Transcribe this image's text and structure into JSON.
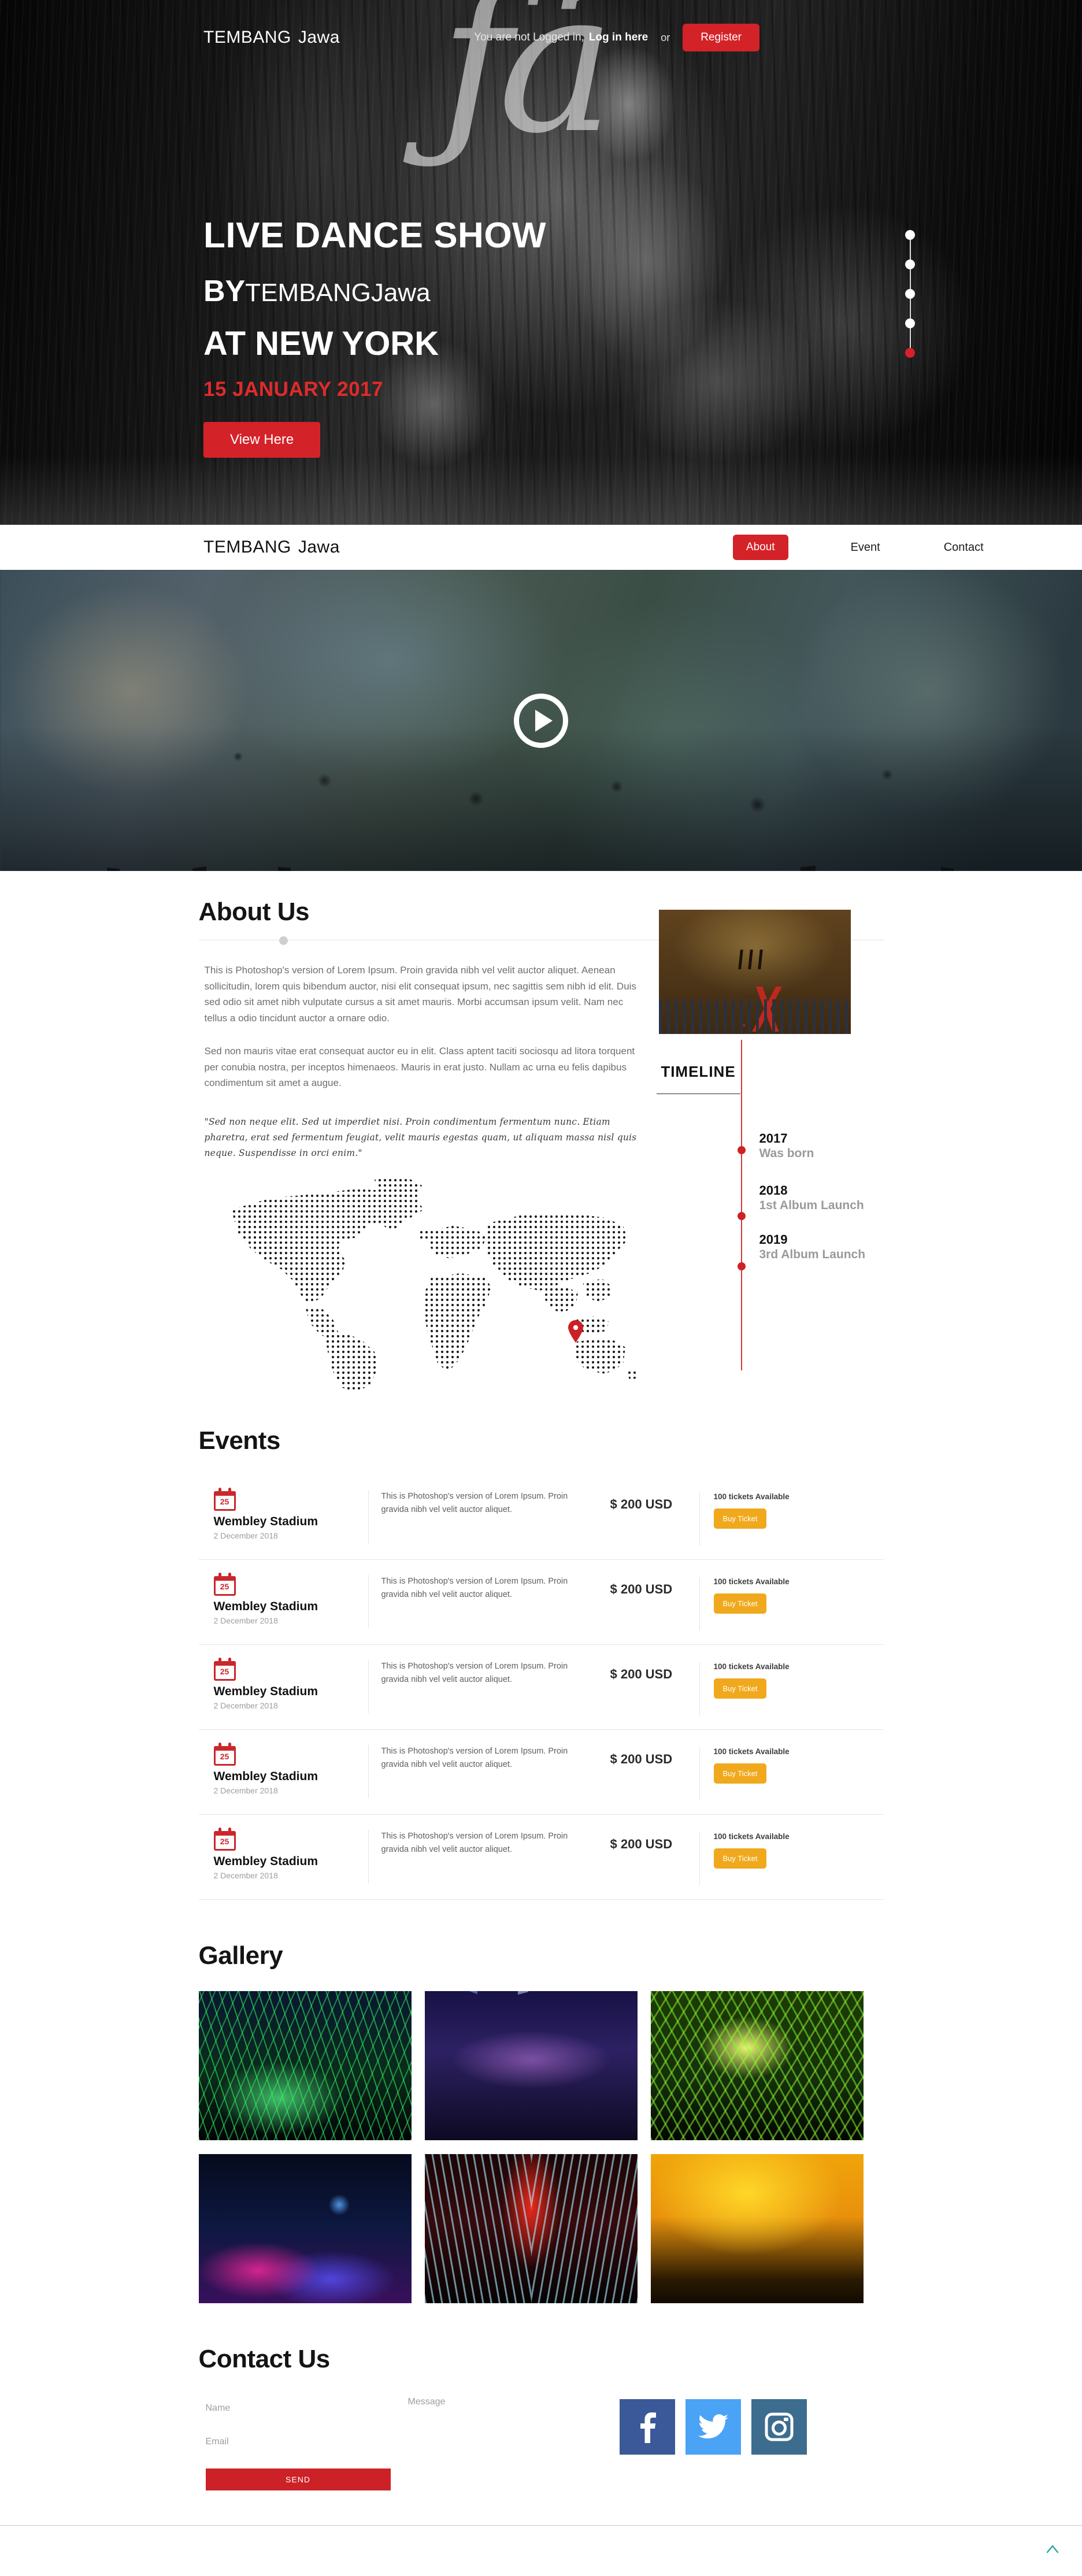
{
  "hero": {
    "brand_primary": "TEMBANG",
    "brand_secondary": "Jawa",
    "auth_text": "You are not Logged in,",
    "auth_link": "Log in here",
    "auth_or": "or",
    "register_label": "Register",
    "headline": "LIVE DANCE SHOW",
    "by_prefix": "BY",
    "by_brand": "TEMBANG",
    "by_brand2": "Jawa",
    "location_line": "AT NEW YORK",
    "date_line": "15 JANUARY 2017",
    "cta_label": "View Here",
    "slider_dots": 5,
    "slider_active_index": 4,
    "accent_color": "#d42229"
  },
  "navbar": {
    "brand_primary": "TEMBANG",
    "brand_secondary": "Jawa",
    "items": [
      {
        "label": "About",
        "active": true
      },
      {
        "label": "Event",
        "active": false
      },
      {
        "label": "Contact",
        "active": false
      }
    ]
  },
  "video": {
    "play_label": "play-video"
  },
  "about": {
    "title": "About Us",
    "paragraph1": "This is Photoshop's version of Lorem Ipsum. Proin gravida nibh vel velit auctor aliquet. Aenean sollicitudin, lorem quis bibendum auctor, nisi elit consequat ipsum, nec sagittis sem nibh id elit. Duis sed odio sit amet nibh vulputate cursus a sit amet mauris. Morbi accumsan ipsum velit. Nam nec tellus a odio tincidunt auctor a ornare odio.",
    "paragraph2": "Sed non mauris vitae erat consequat auctor eu in elit. Class aptent taciti sociosqu ad litora torquent per conubia nostra, per inceptos himenaeos. Mauris in erat justo. Nullam ac urna eu felis dapibus condimentum sit amet a augue.",
    "quote": "\"Sed non neque elit. Sed ut imperdiet nisi. Proin condimentum fermentum nunc. Etiam pharetra, erat sed fermentum feugiat, velit mauris egestas quam, ut aliquam massa nisl quis neque. Suspendisse in orci enim.\""
  },
  "timeline": {
    "title": "TIMELINE",
    "items": [
      {
        "year": "2017",
        "label": "Was born"
      },
      {
        "year": "2018",
        "label": "1st Album Launch"
      },
      {
        "year": "2019",
        "label": "3rd Album Launch"
      }
    ],
    "axis_color": "#cf3b3b"
  },
  "events": {
    "title": "Events",
    "rows": [
      {
        "day": "25",
        "venue": "Wembley Stadium",
        "date": "2 December 2018",
        "desc": "This is Photoshop's version of Lorem Ipsum. Proin gravida nibh vel velit auctor aliquet.",
        "price": "$ 200 USD",
        "tickets": "100 tickets Available",
        "buy_label": "Buy Ticket"
      },
      {
        "day": "25",
        "venue": "Wembley Stadium",
        "date": "2 December 2018",
        "desc": "This is Photoshop's version of Lorem Ipsum. Proin gravida nibh vel velit auctor aliquet.",
        "price": "$ 200 USD",
        "tickets": "100 tickets Available",
        "buy_label": "Buy Ticket"
      },
      {
        "day": "25",
        "venue": "Wembley Stadium",
        "date": "2 December 2018",
        "desc": "This is Photoshop's version of Lorem Ipsum. Proin gravida nibh vel velit auctor aliquet.",
        "price": "$ 200 USD",
        "tickets": "100 tickets Available",
        "buy_label": "Buy Ticket"
      },
      {
        "day": "25",
        "venue": "Wembley Stadium",
        "date": "2 December 2018",
        "desc": "This is Photoshop's version of Lorem Ipsum. Proin gravida nibh vel velit auctor aliquet.",
        "price": "$ 200 USD",
        "tickets": "100 tickets Available",
        "buy_label": "Buy Ticket"
      },
      {
        "day": "25",
        "venue": "Wembley Stadium",
        "date": "2 December 2018",
        "desc": "This is Photoshop's version of Lorem Ipsum. Proin gravida nibh vel velit auctor aliquet.",
        "price": "$ 200 USD",
        "tickets": "100 tickets Available",
        "buy_label": "Buy Ticket"
      }
    ],
    "buy_button_color": "#f0a91d"
  },
  "gallery": {
    "title": "Gallery",
    "items": [
      {
        "name": "green-laser-concert"
      },
      {
        "name": "arena-crowd-stage"
      },
      {
        "name": "green-yellow-laser-crowd"
      },
      {
        "name": "pink-blue-crowd"
      },
      {
        "name": "red-blue-laser-stage"
      },
      {
        "name": "yellow-crowd-hands"
      }
    ]
  },
  "contact": {
    "title": "Contact Us",
    "name_placeholder": "Name",
    "email_placeholder": "Email",
    "message_placeholder": "Message",
    "send_label": "SEND",
    "send_color": "#cc2127",
    "socials": [
      {
        "name": "facebook",
        "color": "#3b5998"
      },
      {
        "name": "twitter",
        "color": "#4aa3f5"
      },
      {
        "name": "instagram",
        "color": "#3d6d8e"
      }
    ]
  },
  "footer": {
    "scroll_top_name": "scroll-to-top"
  }
}
